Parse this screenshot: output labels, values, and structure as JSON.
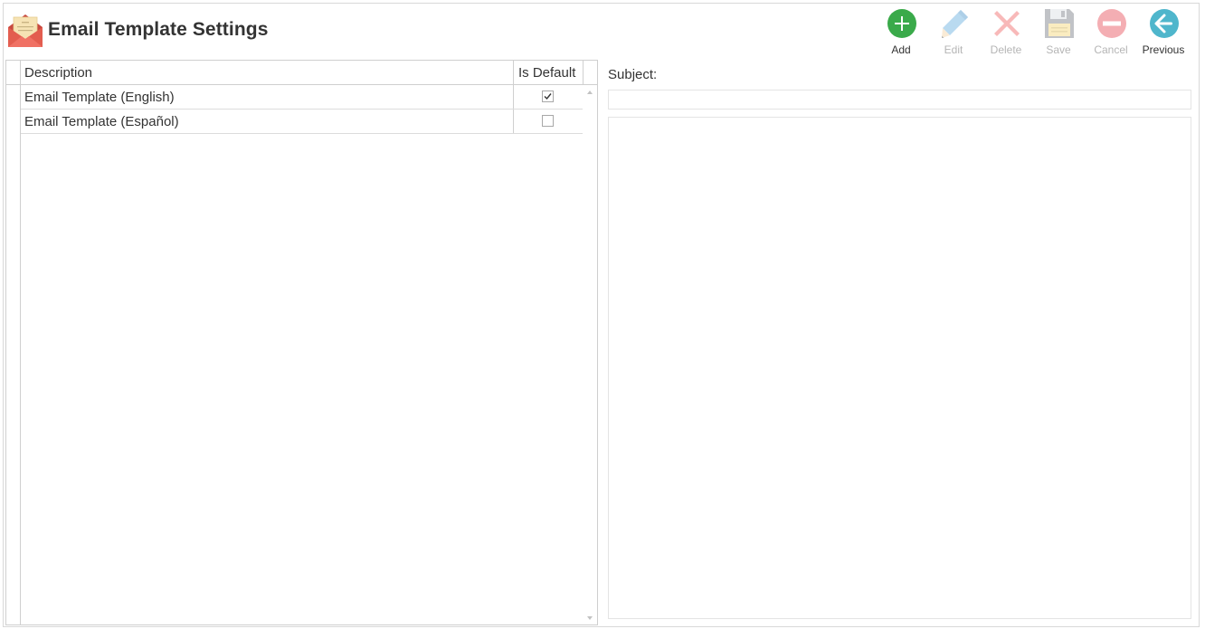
{
  "header": {
    "title": "Email Template Settings",
    "icon": "open-envelope-letter-icon"
  },
  "toolbar": {
    "add": {
      "label": "Add",
      "icon": "plus-circle-icon",
      "color": "#3aaa4a"
    },
    "edit": {
      "label": "Edit",
      "icon": "pencil-icon",
      "color": "#7fbde6"
    },
    "delete": {
      "label": "Delete",
      "icon": "x-icon",
      "color": "#f07a7a"
    },
    "save": {
      "label": "Save",
      "icon": "floppy-disk-icon",
      "color": "#8a8f96"
    },
    "cancel": {
      "label": "Cancel",
      "icon": "minus-circle-icon",
      "color": "#e5606a"
    },
    "previous": {
      "label": "Previous",
      "icon": "arrow-left-circle-icon",
      "color": "#4fb6cc"
    }
  },
  "grid": {
    "columns": {
      "description": "Description",
      "is_default": "Is Default"
    },
    "rows": [
      {
        "description": "Email Template (English)",
        "is_default": true
      },
      {
        "description": "Email Template (Español)",
        "is_default": false
      }
    ]
  },
  "editor": {
    "subject_label": "Subject:",
    "subject_value": "",
    "body_value": ""
  }
}
